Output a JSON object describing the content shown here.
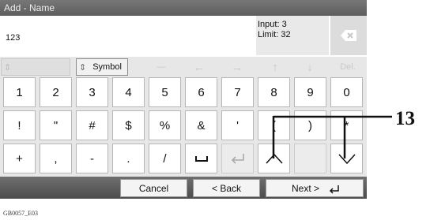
{
  "title": "Add - Name",
  "input": {
    "value": "123",
    "counter_input": "Input: 3",
    "counter_limit": "Limit: 32"
  },
  "icons": {
    "delete": "backspace-x-icon",
    "input_mode": "input-mode-selector-icon",
    "space": "space-icon",
    "enter": "enter-icon",
    "arrows": "arrow-icons"
  },
  "function_row": {
    "symbol": "Symbol",
    "dash": "—",
    "left": "←",
    "right": "→",
    "up": "↑",
    "down": "↓",
    "del": "Del."
  },
  "rows": [
    [
      "1",
      "2",
      "3",
      "4",
      "5",
      "6",
      "7",
      "8",
      "9",
      "0"
    ],
    [
      "!",
      "\"",
      "#",
      "$",
      "%",
      "&",
      "'",
      "(",
      ")",
      "*"
    ],
    [
      "+",
      ",",
      "-",
      ".",
      "/",
      "␣",
      "⏎",
      "^",
      "",
      "v"
    ]
  ],
  "bottom": {
    "cancel": "Cancel",
    "back": "< Back",
    "next": "Next >"
  },
  "callout": "13",
  "footer": "GB0057_E03"
}
